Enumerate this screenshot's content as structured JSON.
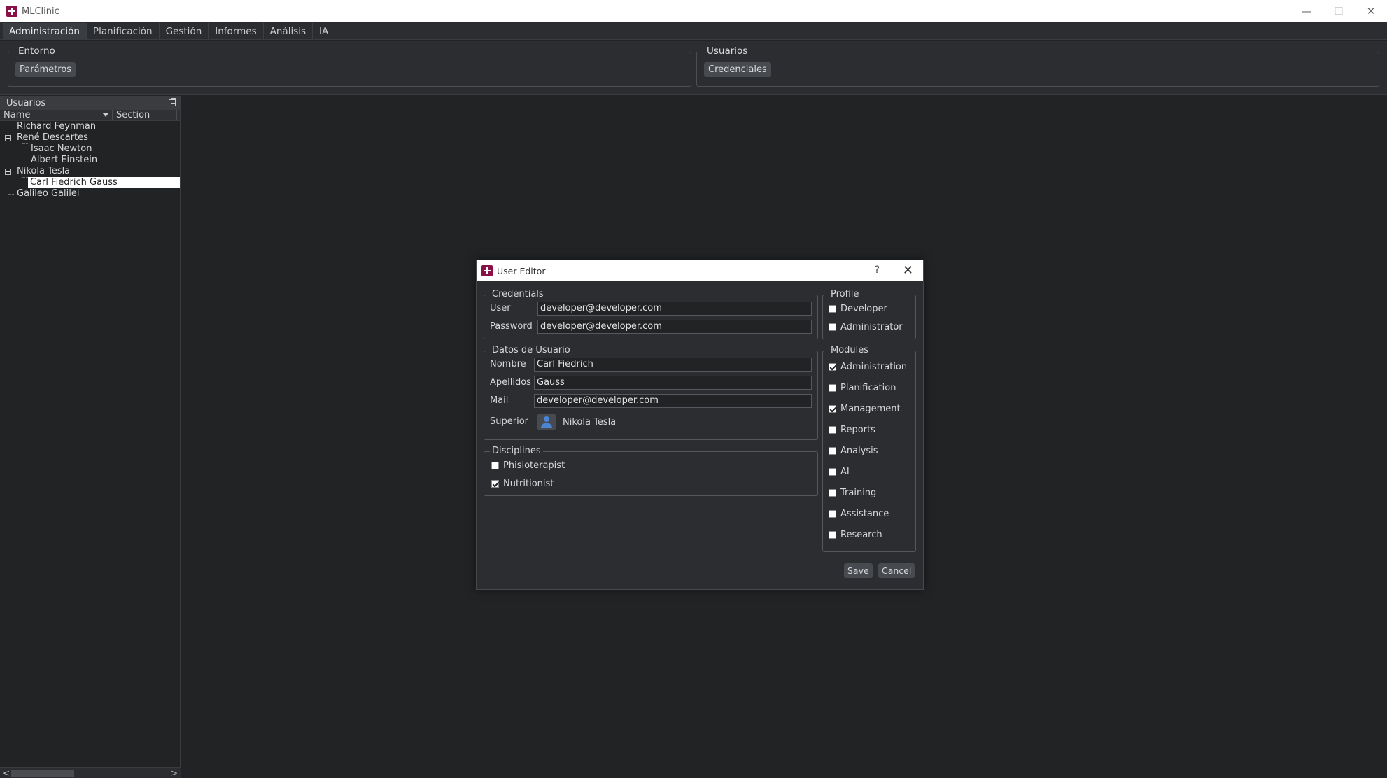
{
  "window": {
    "title": "MLClinic",
    "controls": {
      "minimize": "—",
      "maximize": "☐",
      "close": "✕"
    }
  },
  "menu": {
    "tabs": [
      "Administración",
      "Planificación",
      "Gestión",
      "Informes",
      "Análisis",
      "IA"
    ],
    "active": "Administración"
  },
  "ribbon": {
    "entorno": {
      "title": "Entorno",
      "button": "Parámetros"
    },
    "usuarios": {
      "title": "Usuarios",
      "button": "Credenciales"
    }
  },
  "left_panel": {
    "title": "Usuarios",
    "columns": {
      "name": "Name",
      "section": "Section"
    },
    "tree": [
      {
        "label": "Richard Feynman",
        "level": 0
      },
      {
        "label": "René Descartes",
        "level": 0,
        "expanded": true
      },
      {
        "label": "Isaac Newton",
        "level": 1
      },
      {
        "label": "Albert Einstein",
        "level": 1
      },
      {
        "label": "Nikola Tesla",
        "level": 0,
        "expanded": true
      },
      {
        "label": "Carl Fiedrich Gauss",
        "level": 1,
        "selected": true
      },
      {
        "label": "Galileo Galilei",
        "level": 0
      }
    ],
    "scroll": {
      "left": "<",
      "right": ">"
    }
  },
  "dialog": {
    "title": "User Editor",
    "help": "?",
    "close": "✕",
    "credentials": {
      "legend": "Credentials",
      "user_label": "User",
      "user_value": "developer@developer.com",
      "password_label": "Password",
      "password_value": "developer@developer.com"
    },
    "user_data": {
      "legend": "Datos de Usuario",
      "nombre_label": "Nombre",
      "nombre_value": "Carl Fiedrich",
      "apellidos_label": "Apellidos",
      "apellidos_value": "Gauss",
      "mail_label": "Mail",
      "mail_value": "developer@developer.com",
      "superior_label": "Superior",
      "superior_value": "Nikola Tesla"
    },
    "disciplines": {
      "legend": "Disciplines",
      "items": [
        {
          "label": "Phisioterapist",
          "checked": false
        },
        {
          "label": "Nutritionist",
          "checked": true
        }
      ]
    },
    "profile": {
      "legend": "Profile",
      "items": [
        {
          "label": "Developer",
          "checked": false
        },
        {
          "label": "Administrator",
          "checked": false
        }
      ]
    },
    "modules": {
      "legend": "Modules",
      "items": [
        {
          "label": "Administration",
          "checked": true
        },
        {
          "label": "Planification",
          "checked": false
        },
        {
          "label": "Management",
          "checked": true
        },
        {
          "label": "Reports",
          "checked": false
        },
        {
          "label": "Analysis",
          "checked": false
        },
        {
          "label": "AI",
          "checked": false
        },
        {
          "label": "Training",
          "checked": false
        },
        {
          "label": "Assistance",
          "checked": false
        },
        {
          "label": "Research",
          "checked": false
        }
      ]
    },
    "save_label": "Save",
    "cancel_label": "Cancel"
  },
  "colors": {
    "background": "#212325",
    "panel": "#2b2d30",
    "accent": "#8a1147",
    "avatar": "#4b86d6"
  }
}
